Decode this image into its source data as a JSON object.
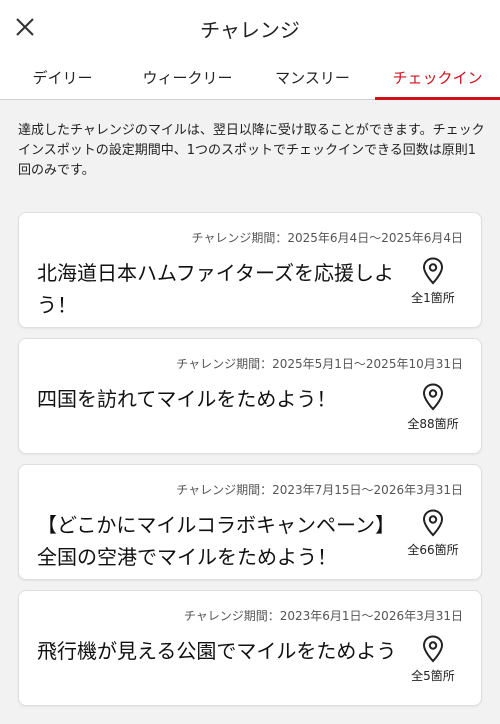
{
  "header": {
    "title": "チャレンジ",
    "close_icon": "close-icon"
  },
  "tabs": [
    {
      "label": "デイリー",
      "active": false
    },
    {
      "label": "ウィークリー",
      "active": false
    },
    {
      "label": "マンスリー",
      "active": false
    },
    {
      "label": "チェックイン",
      "active": true
    }
  ],
  "notice": "達成したチャレンジのマイルは、翌日以降に受け取ることができます。チェックインスポットの設定期間中、1つのスポットでチェックインできる回数は原則1回のみです。",
  "challenges": [
    {
      "period": "チャレンジ期間：2025年6月4日〜2025年6月4日",
      "name": "北海道日本ハムファイターズを応援しよう！",
      "count": "全1箇所"
    },
    {
      "period": "チャレンジ期間：2025年5月1日〜2025年10月31日",
      "name": "四国を訪れてマイルをためよう！",
      "count": "全88箇所"
    },
    {
      "period": "チャレンジ期間：2023年7月15日〜2026年3月31日",
      "name": "【どこかにマイルコラボキャンペーン】全国の空港でマイルをためよう！",
      "count": "全66箇所"
    },
    {
      "period": "チャレンジ期間：2023年6月1日〜2026年3月31日",
      "name": "飛行機が見える公園でマイルをためよう",
      "count": "全5箇所"
    }
  ],
  "colors": {
    "accent": "#d0111b",
    "background": "#f2f2f2"
  }
}
